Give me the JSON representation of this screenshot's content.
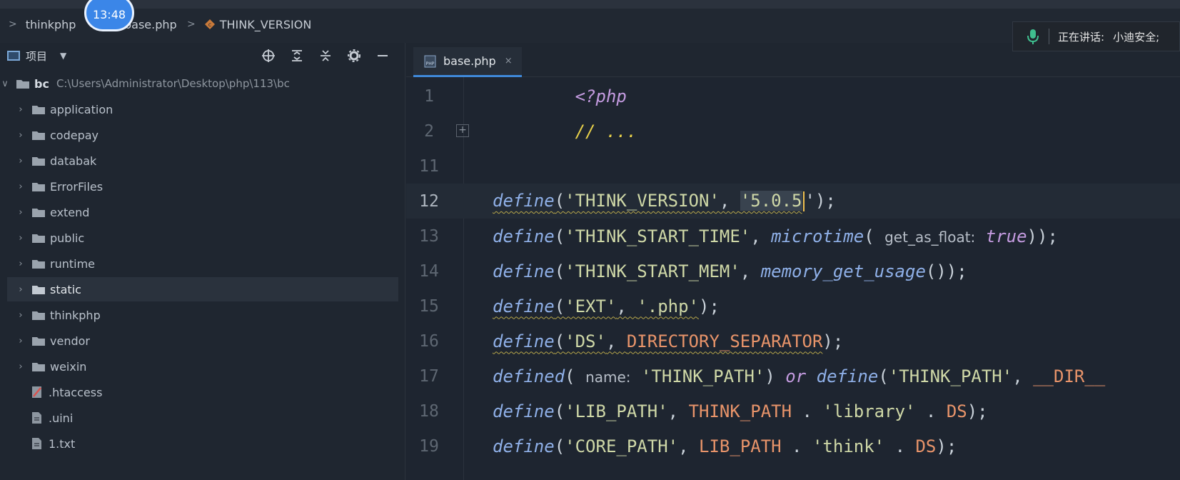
{
  "breadcrumb": {
    "items": [
      "thinkphp",
      "base.php",
      "THINK_VERSION"
    ]
  },
  "clock": {
    "time": "13:48"
  },
  "voice": {
    "label": "正在讲话:",
    "speaker": "小迪安全;"
  },
  "panel": {
    "title": "项目",
    "tools": [
      "crosshair-icon",
      "expand-icon",
      "collapse-icon",
      "gear-icon",
      "minimize-icon"
    ],
    "root": {
      "name": "bc",
      "path": "C:\\Users\\Administrator\\Desktop\\php\\113\\bc"
    },
    "folders": [
      "application",
      "codepay",
      "databak",
      "ErrorFiles",
      "extend",
      "public",
      "runtime",
      "static",
      "thinkphp",
      "vendor",
      "weixin"
    ],
    "files": [
      ".htaccess",
      ".uini",
      "1.txt"
    ],
    "selected": "static"
  },
  "editor": {
    "tab": {
      "label": "base.php",
      "close": "×"
    },
    "lines": [
      {
        "n": "1"
      },
      {
        "n": "2"
      },
      {
        "n": "11"
      },
      {
        "n": "12"
      },
      {
        "n": "13"
      },
      {
        "n": "14"
      },
      {
        "n": "15"
      },
      {
        "n": "16"
      },
      {
        "n": "17"
      },
      {
        "n": "18"
      },
      {
        "n": "19"
      }
    ],
    "code": {
      "l1": {
        "tag": "<?php"
      },
      "l2": {
        "comment": "// ..."
      },
      "l12": {
        "fn": "define",
        "open": "(",
        "key": "'THINK_VERSION'",
        "comma": ", ",
        "val": "'5.0.5",
        "after": "');"
      },
      "l13": {
        "fn": "define",
        "open": "(",
        "key": "'THINK_START_TIME'",
        "comma": ", ",
        "fn2": "microtime",
        "open2": "( ",
        "hint": "get_as_float:",
        "val": " true",
        "close": "));"
      },
      "l14": {
        "fn": "define",
        "open": "(",
        "key": "'THINK_START_MEM'",
        "comma": ", ",
        "fn2": "memory_get_usage",
        "close": "());"
      },
      "l15": {
        "fn": "define",
        "open": "(",
        "key": "'EXT'",
        "comma": ", ",
        "val": "'.php'",
        "close": ");"
      },
      "l16": {
        "fn": "define",
        "open": "(",
        "key": "'DS'",
        "comma": ", ",
        "const": "DIRECTORY_SEPARATOR",
        "close": ");"
      },
      "l17": {
        "fn": "defined",
        "open": "( ",
        "hint": "name:",
        "key": " 'THINK_PATH'",
        "close1": ") ",
        "or": "or",
        "fn2": " define",
        "open2": "(",
        "key2": "'THINK_PATH'",
        "comma": ", ",
        "const": "__DIR__"
      },
      "l18": {
        "fn": "define",
        "open": "(",
        "key": "'LIB_PATH'",
        "comma": ", ",
        "const": "THINK_PATH",
        "dot": " . ",
        "str": "'library'",
        "dot2": " . ",
        "const2": "DS",
        "close": ");"
      },
      "l19": {
        "fn": "define",
        "open": "(",
        "key": "'CORE_PATH'",
        "comma": ", ",
        "const": "LIB_PATH",
        "dot": " . ",
        "str": "'think'",
        "dot2": " . ",
        "const2": "DS",
        "close": ");"
      }
    }
  }
}
